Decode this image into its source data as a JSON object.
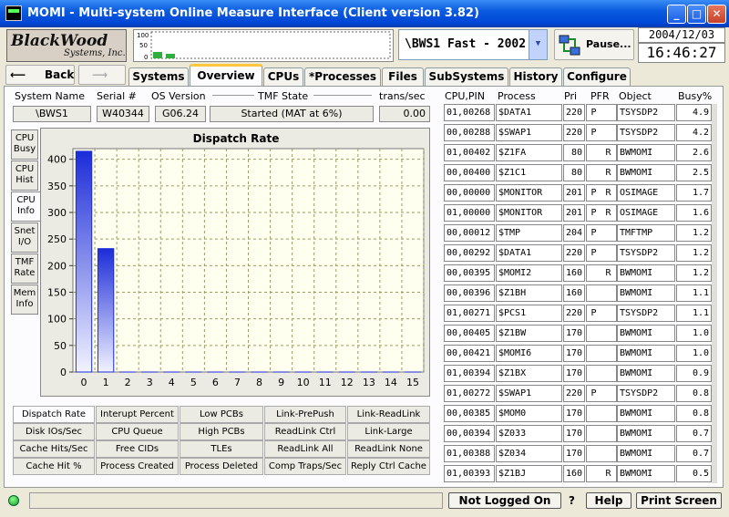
{
  "window": {
    "title": "MOMI - Multi-system Online Measure Interface (Client version 3.82)"
  },
  "logo": {
    "line1": "BlackWood",
    "line2": "Systems, Inc."
  },
  "spark": {
    "ticks": [
      "100",
      "50",
      "0"
    ]
  },
  "system_select": {
    "value": "\\BWS1 Fast - 2002"
  },
  "pause": {
    "label": "Pause..."
  },
  "clock": {
    "date": "2004/12/03",
    "time": "16:46:27"
  },
  "nav": {
    "back": "Back"
  },
  "tabs": [
    "Systems",
    "Overview",
    "CPUs",
    "*Processes",
    "Files",
    "SubSystems",
    "History",
    "Configure"
  ],
  "active_tab": "Overview",
  "sysinfo": {
    "headers": {
      "name": "System Name",
      "serial": "Serial #",
      "os": "OS Version",
      "tmf": "TMF State",
      "trans": "trans/sec"
    },
    "values": {
      "name": "\\BWS1",
      "serial": "W40344",
      "os": "G06.24",
      "tmf": "Started (MAT at 6%)",
      "trans": "0.00"
    }
  },
  "side_tabs": [
    {
      "l1": "CPU",
      "l2": "Busy"
    },
    {
      "l1": "CPU",
      "l2": "Hist"
    },
    {
      "l1": "CPU",
      "l2": "Info"
    },
    {
      "l1": "Snet",
      "l2": "I/O"
    },
    {
      "l1": "TMF",
      "l2": "Rate"
    },
    {
      "l1": "Mem",
      "l2": "Info"
    }
  ],
  "chart_data": {
    "type": "bar",
    "title": "Dispatch Rate",
    "categories": [
      "0",
      "1",
      "2",
      "3",
      "4",
      "5",
      "6",
      "7",
      "8",
      "9",
      "10",
      "11",
      "12",
      "13",
      "14",
      "15"
    ],
    "values": [
      415,
      232,
      0,
      0,
      0,
      0,
      0,
      0,
      0,
      0,
      0,
      0,
      0,
      0,
      0,
      0
    ],
    "xlabel": "",
    "ylabel": "",
    "ylim": [
      0,
      420
    ],
    "yticks": [
      0,
      50,
      100,
      150,
      200,
      250,
      300,
      350,
      400
    ],
    "grid": true,
    "colors": {
      "bar_top": "#1c2cd8",
      "bar_bottom": "#f2f2ff",
      "plot_bg": "#fffff0",
      "grid": "#9a9a6a"
    }
  },
  "graph_buttons": [
    [
      "Dispatch Rate",
      "Interupt Percent",
      "Low PCBs",
      "Link-PrePush",
      "Link-ReadLink"
    ],
    [
      "Disk IOs/Sec",
      "CPU Queue",
      "High PCBs",
      "ReadLink Ctrl",
      "Link-Large"
    ],
    [
      "Cache Hits/Sec",
      "Free CIDs",
      "TLEs",
      "ReadLink All",
      "ReadLink None"
    ],
    [
      "Cache Hit %",
      "Process Created",
      "Process Deleted",
      "Comp Traps/Sec",
      "Reply Ctrl Cache"
    ]
  ],
  "process_table": {
    "headers": [
      "CPU,PIN",
      "Process",
      "Pri",
      "PFR",
      "Object",
      "Busy%"
    ],
    "rows": [
      [
        "01,00268",
        "$DATA1",
        "220",
        "P",
        "",
        "TSYSDP2",
        "4.9"
      ],
      [
        "00,00288",
        "$SWAP1",
        "220",
        "P",
        "",
        "TSYSDP2",
        "4.2"
      ],
      [
        "01,00402",
        "$Z1FA",
        "80",
        "",
        "R",
        "BWMOMI",
        "2.6"
      ],
      [
        "00,00400",
        "$Z1C1",
        "80",
        "",
        "R",
        "BWMOMI",
        "2.5"
      ],
      [
        "00,00000",
        "$MONITOR",
        "201",
        "P",
        "R",
        "OSIMAGE",
        "1.7"
      ],
      [
        "01,00000",
        "$MONITOR",
        "201",
        "P",
        "R",
        "OSIMAGE",
        "1.6"
      ],
      [
        "00,00012",
        "$TMP",
        "204",
        "P",
        "",
        "TMFTMP",
        "1.2"
      ],
      [
        "00,00292",
        "$DATA1",
        "220",
        "P",
        "",
        "TSYSDP2",
        "1.2"
      ],
      [
        "00,00395",
        "$MOMI2",
        "160",
        "",
        "R",
        "BWMOMI",
        "1.2"
      ],
      [
        "00,00396",
        "$Z1BH",
        "160",
        "",
        "",
        "BWMOMI",
        "1.1"
      ],
      [
        "01,00271",
        "$PCS1",
        "220",
        "P",
        "",
        "TSYSDP2",
        "1.1"
      ],
      [
        "00,00405",
        "$Z1BW",
        "170",
        "",
        "",
        "BWMOMI",
        "1.0"
      ],
      [
        "00,00421",
        "$MOMI6",
        "170",
        "",
        "",
        "BWMOMI",
        "1.0"
      ],
      [
        "01,00394",
        "$Z1BX",
        "170",
        "",
        "",
        "BWMOMI",
        "0.9"
      ],
      [
        "01,00272",
        "$SWAP1",
        "220",
        "P",
        "",
        "TSYSDP2",
        "0.8"
      ],
      [
        "00,00385",
        "$MOM0",
        "170",
        "",
        "",
        "BWMOMI",
        "0.8"
      ],
      [
        "00,00394",
        "$Z033",
        "170",
        "",
        "",
        "BWMOMI",
        "0.7"
      ],
      [
        "01,00388",
        "$Z034",
        "170",
        "",
        "",
        "BWMOMI",
        "0.7"
      ],
      [
        "01,00393",
        "$Z1BJ",
        "160",
        "",
        "R",
        "BWMOMI",
        "0.5"
      ]
    ]
  },
  "statusbar": {
    "login": "Not Logged On",
    "q": "?",
    "help": "Help",
    "print": "Print Screen"
  }
}
